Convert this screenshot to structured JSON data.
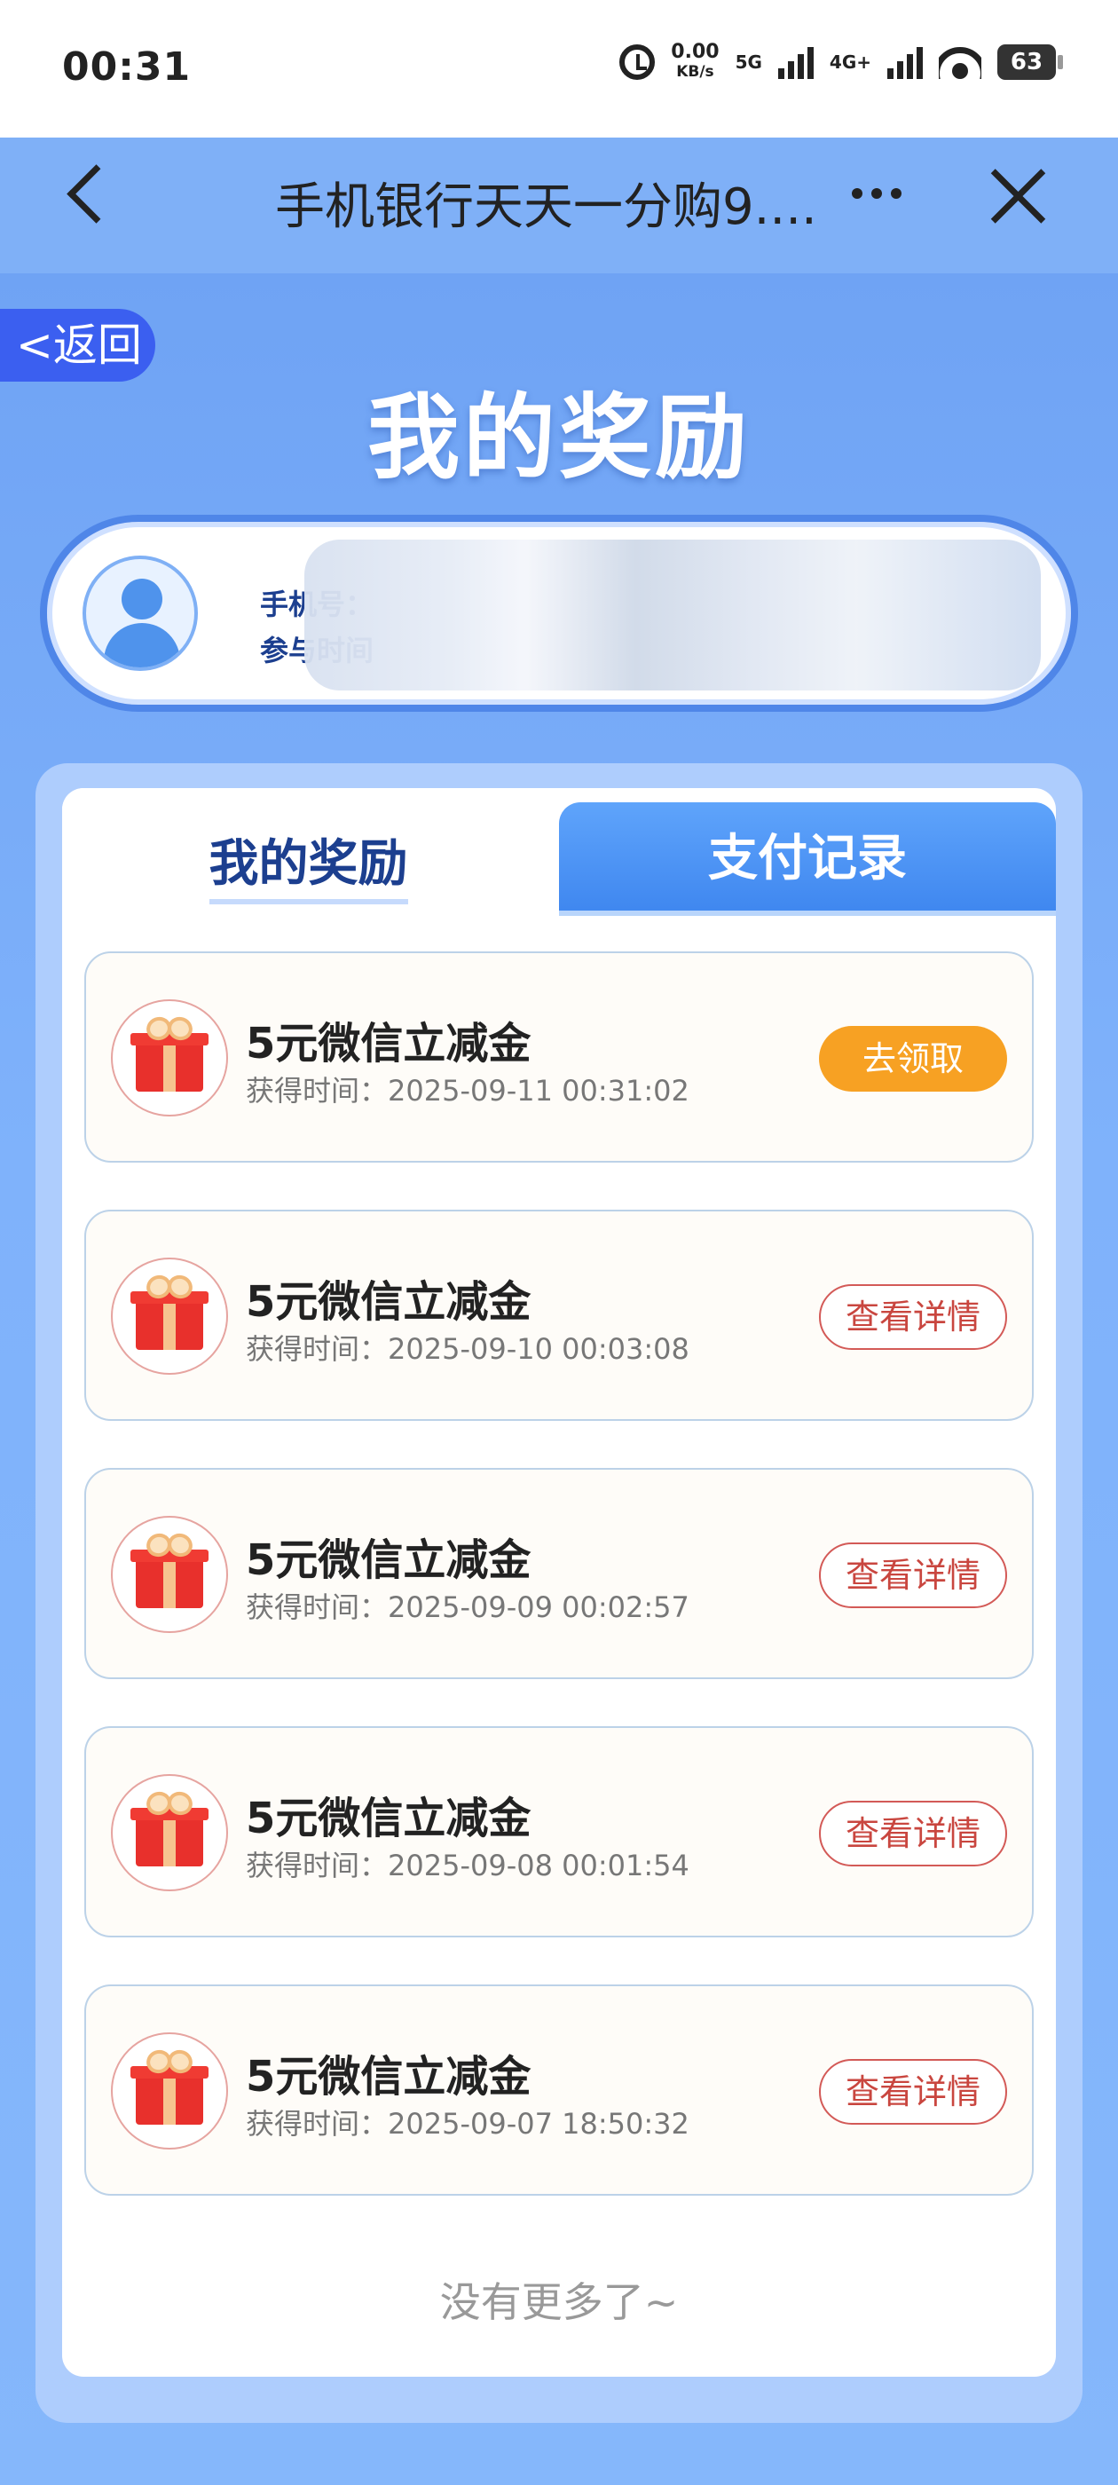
{
  "status_bar": {
    "time": "00:31",
    "speed": "0.00",
    "speed_unit": "KB/s",
    "net1": "5G",
    "net2": "4G+",
    "battery": "63"
  },
  "title_bar": {
    "title": "手机银行天天一分购9...."
  },
  "page": {
    "return_label": "<返回",
    "title": "我的奖励"
  },
  "user": {
    "phone_label": "手机号：",
    "time_label": "参与时间"
  },
  "tabs": [
    {
      "label": "我的奖励",
      "active": true
    },
    {
      "label": "支付记录",
      "active": false
    }
  ],
  "rewards": [
    {
      "title": "5元微信立减金",
      "time": "获得时间：2025-09-11 00:31:02",
      "action": "去领取"
    },
    {
      "title": "5元微信立减金",
      "time": "获得时间：2025-09-10 00:03:08",
      "action": "查看详情"
    },
    {
      "title": "5元微信立减金",
      "time": "获得时间：2025-09-09 00:02:57",
      "action": "查看详情"
    },
    {
      "title": "5元微信立减金",
      "time": "获得时间：2025-09-08 00:01:54",
      "action": "查看详情"
    },
    {
      "title": "5元微信立减金",
      "time": "获得时间：2025-09-07 18:50:32",
      "action": "查看详情"
    }
  ],
  "footer": {
    "no_more": "没有更多了~"
  },
  "colors": {
    "accent": "#3b5ff0",
    "claim": "#f7a123",
    "detail": "#c9463f",
    "tab_active_text": "#1c3f8f"
  }
}
